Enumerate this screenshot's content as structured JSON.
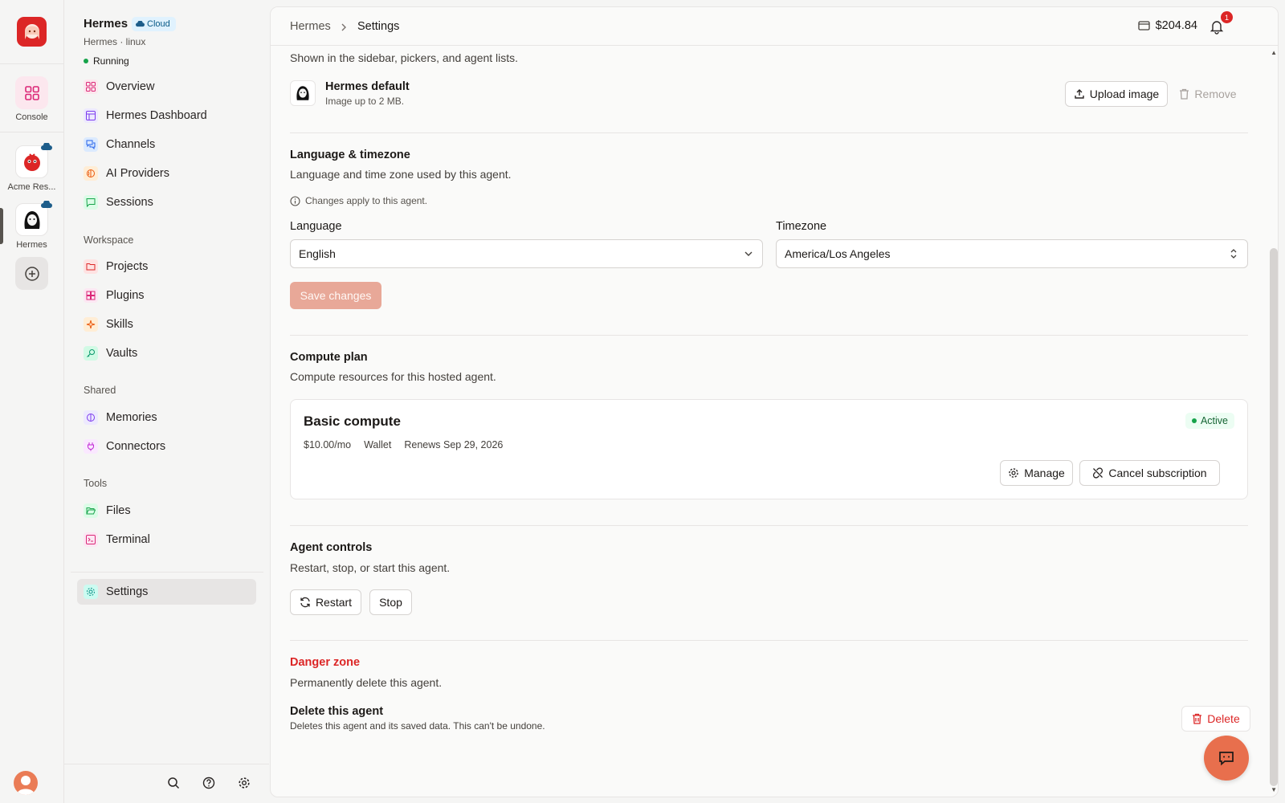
{
  "rail": {
    "console_label": "Console",
    "acme_label": "Acme Res...",
    "hermes_label": "Hermes"
  },
  "sidebar": {
    "agent_name": "Hermes",
    "cloud_badge": "Cloud",
    "agent_sub": "Hermes · linux",
    "status": "Running",
    "main_items": [
      {
        "label": "Overview"
      },
      {
        "label": "Hermes Dashboard"
      },
      {
        "label": "Channels"
      },
      {
        "label": "AI Providers"
      },
      {
        "label": "Sessions"
      }
    ],
    "workspace_label": "Workspace",
    "workspace_items": [
      {
        "label": "Projects"
      },
      {
        "label": "Plugins"
      },
      {
        "label": "Skills"
      },
      {
        "label": "Vaults"
      }
    ],
    "shared_label": "Shared",
    "shared_items": [
      {
        "label": "Memories"
      },
      {
        "label": "Connectors"
      }
    ],
    "tools_label": "Tools",
    "tools_items": [
      {
        "label": "Files"
      },
      {
        "label": "Terminal"
      }
    ],
    "settings_label": "Settings"
  },
  "topbar": {
    "crumb_root": "Hermes",
    "crumb_current": "Settings",
    "balance": "$204.84",
    "notification_count": "1"
  },
  "avatar_section": {
    "desc": "Shown in the sidebar, pickers, and agent lists.",
    "name": "Hermes default",
    "hint": "Image up to 2 MB.",
    "upload_label": "Upload image",
    "remove_label": "Remove"
  },
  "language": {
    "title": "Language & timezone",
    "desc": "Language and time zone used by this agent.",
    "note": "Changes apply to this agent.",
    "language_label": "Language",
    "language_value": "English",
    "timezone_label": "Timezone",
    "timezone_value": "America/Los Angeles",
    "save_label": "Save changes"
  },
  "compute": {
    "title": "Compute plan",
    "desc": "Compute resources for this hosted agent.",
    "plan_name": "Basic compute",
    "status": "Active",
    "price": "$10.00/mo",
    "payment": "Wallet",
    "renews": "Renews Sep 29, 2026",
    "manage_label": "Manage",
    "cancel_label": "Cancel subscription"
  },
  "controls": {
    "title": "Agent controls",
    "desc": "Restart, stop, or start this agent.",
    "restart_label": "Restart",
    "stop_label": "Stop"
  },
  "danger": {
    "title": "Danger zone",
    "desc": "Permanently delete this agent.",
    "delete_title": "Delete this agent",
    "delete_desc": "Deletes this agent and its saved data. This can't be undone.",
    "delete_label": "Delete"
  },
  "colors": {
    "accent": "#e86f4d",
    "danger": "#dc2626",
    "save_disabled": "#e8a898",
    "active_badge_bg": "#ecfdf3",
    "active_badge_text": "#166534"
  }
}
